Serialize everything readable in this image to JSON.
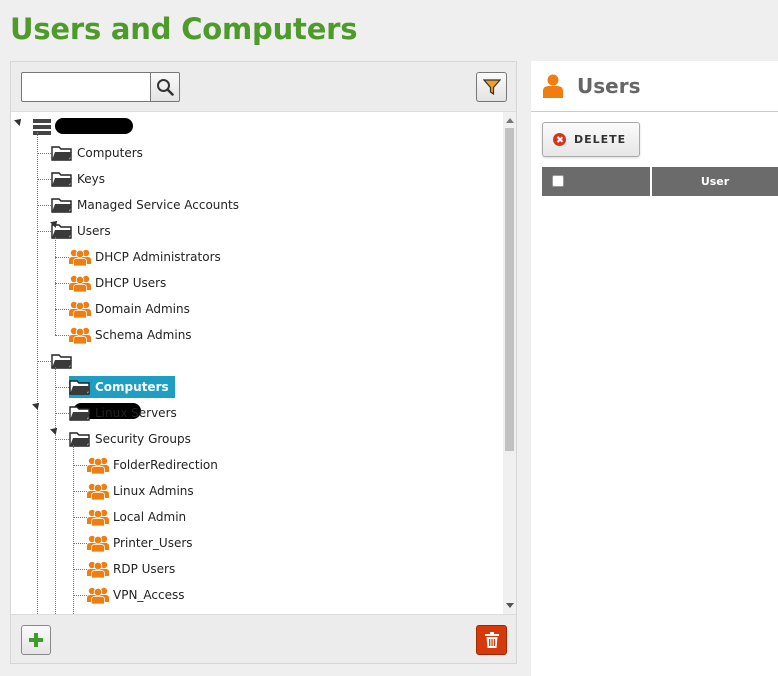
{
  "page": {
    "title": "Users and Computers"
  },
  "search": {
    "value": "",
    "placeholder": ""
  },
  "tree": {
    "nodes": [
      {
        "label": "Computers"
      },
      {
        "label": "Keys"
      },
      {
        "label": "Managed Service Accounts"
      },
      {
        "label": "Users"
      },
      {
        "label": "DHCP Administrators"
      },
      {
        "label": "DHCP Users"
      },
      {
        "label": "Domain Admins"
      },
      {
        "label": "Schema Admins"
      },
      {
        "label": "Computers"
      },
      {
        "label": "Linux Servers"
      },
      {
        "label": "Security Groups"
      },
      {
        "label": "FolderRedirection"
      },
      {
        "label": "Linux Admins"
      },
      {
        "label": "Local Admin"
      },
      {
        "label": "Printer_Users"
      },
      {
        "label": "RDP Users"
      },
      {
        "label": "VPN_Access"
      }
    ]
  },
  "right_panel": {
    "title": "Users",
    "delete_label": "DELETE",
    "grid": {
      "columns": [
        "User"
      ]
    }
  },
  "colors": {
    "title_green": "#4e9a2a",
    "selected_blue": "#1e9ec2",
    "group_orange": "#f07d10",
    "delete_red": "#d63a0a"
  },
  "icons": {
    "search": "search-icon",
    "filter": "filter-icon",
    "folder": "folder-icon",
    "group": "group-icon",
    "server": "server-icon",
    "add": "plus-icon",
    "trash": "trash-icon",
    "user": "user-icon"
  }
}
